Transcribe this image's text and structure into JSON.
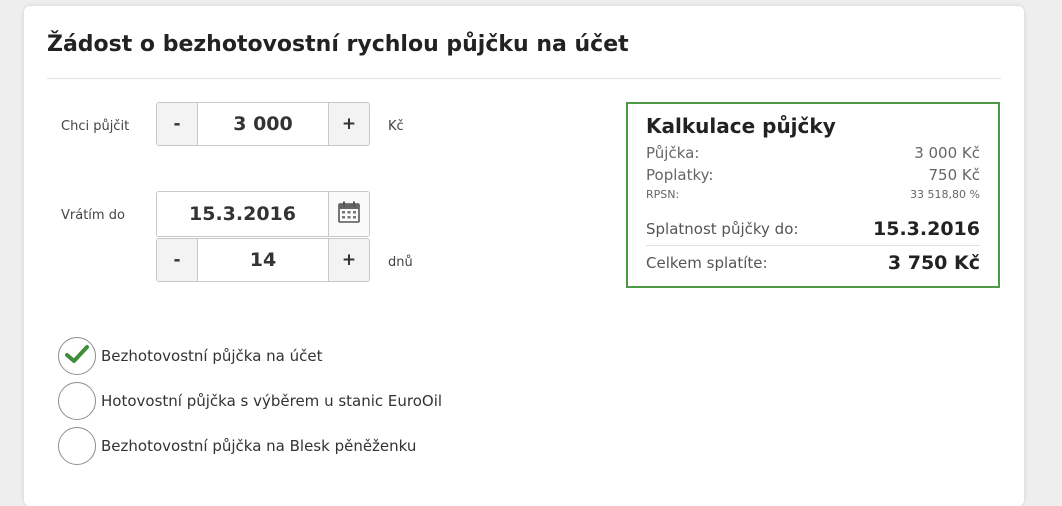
{
  "form": {
    "title": "Žádost o bezhotovostní rychlou půjčku na účet",
    "amount": {
      "label": "Chci půjčit",
      "value": "3 000",
      "unit": "Kč",
      "minus_label": "-",
      "plus_label": "+"
    },
    "return": {
      "label": "Vrátím do",
      "date": "15.3.2016",
      "days_value": "14",
      "days_unit": "dnů",
      "minus_label": "-",
      "plus_label": "+"
    },
    "options": [
      {
        "label": "Bezhotovostní půjčka na účet",
        "selected": true
      },
      {
        "label": "Hotovostní půjčka s výběrem u stanic EuroOil",
        "selected": false
      },
      {
        "label": "Bezhotovostní půjčka na Blesk pěněženku",
        "selected": false
      }
    ]
  },
  "calculator": {
    "title": "Kalkulace půjčky",
    "loan_label": "Půjčka:",
    "loan_value": "3 000 Kč",
    "fees_label": "Poplatky:",
    "fees_value": "750 Kč",
    "rpsn_label": "RPSN:",
    "rpsn_value": "33 518,80 %",
    "due_label": "Splatnost půjčky do:",
    "due_value": "15.3.2016",
    "total_label": "Celkem splatíte:",
    "total_value": "3 750 Kč"
  },
  "colors": {
    "accent_green": "#4f9a47",
    "check_green": "#3f8f3a"
  },
  "icons": {
    "calendar": "calendar-icon",
    "check": "check-icon"
  }
}
